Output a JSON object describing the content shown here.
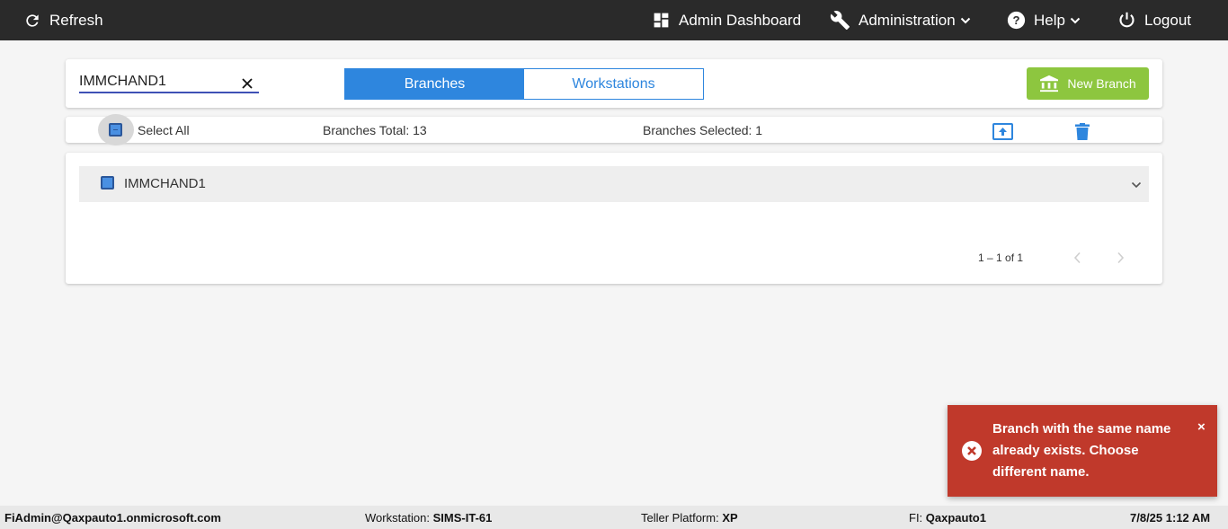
{
  "topbar": {
    "refresh_label": "Refresh",
    "dashboard_label": "Admin Dashboard",
    "administration_label": "Administration",
    "help_label": "Help",
    "logout_label": "Logout"
  },
  "search": {
    "value": "IMMCHAND1"
  },
  "tabs": [
    {
      "label": "Branches",
      "active": true
    },
    {
      "label": "Workstations",
      "active": false
    }
  ],
  "new_branch_label": "New Branch",
  "totals": {
    "select_all_label": "Select All",
    "branches_total": "Branches Total: 13",
    "branches_selected": "Branches Selected: 1"
  },
  "branches": [
    {
      "name": "IMMCHAND1"
    }
  ],
  "pagination": {
    "range": "1 – 1 of 1"
  },
  "toast": {
    "message": "Branch with the same name already exists. Choose different name.",
    "close": "×"
  },
  "status": {
    "user": "FiAdmin@Qaxpauto1.onmicrosoft.com",
    "workstation_label": "Workstation:",
    "workstation_value": "SIMS-IT-61",
    "platform_label": "Teller Platform:",
    "platform_value": "XP",
    "fi_label": "FI:",
    "fi_value": "Qaxpauto1",
    "datetime": "7/8/25 1:12 AM"
  },
  "colors": {
    "topbar": "#2a2a2a",
    "accent": "#2e86de",
    "new_branch": "#8dc63f",
    "error": "#c0392b"
  }
}
